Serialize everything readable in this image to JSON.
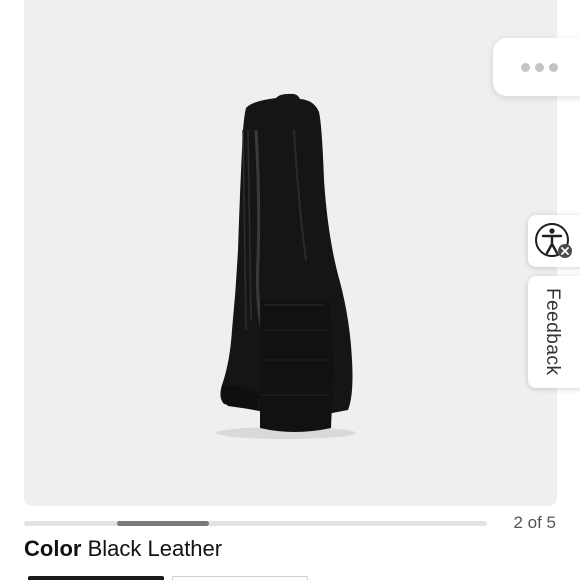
{
  "product": {
    "image_description_icon": "boot-rear-view",
    "color_label": "Color",
    "color_value": "Black Leather"
  },
  "gallery": {
    "current": 2,
    "total": 5,
    "indicator_text": "2 of 5",
    "progress_fraction": 0.2
  },
  "overlay": {
    "more_icon": "more-dots-icon",
    "accessibility_icon": "accessibility-icon",
    "feedback_label": "Feedback"
  },
  "colors": {
    "image_bg": "#efefef",
    "progress_track": "#e3e3e3",
    "progress_thumb": "#7a7a7a",
    "text": "#111111"
  }
}
